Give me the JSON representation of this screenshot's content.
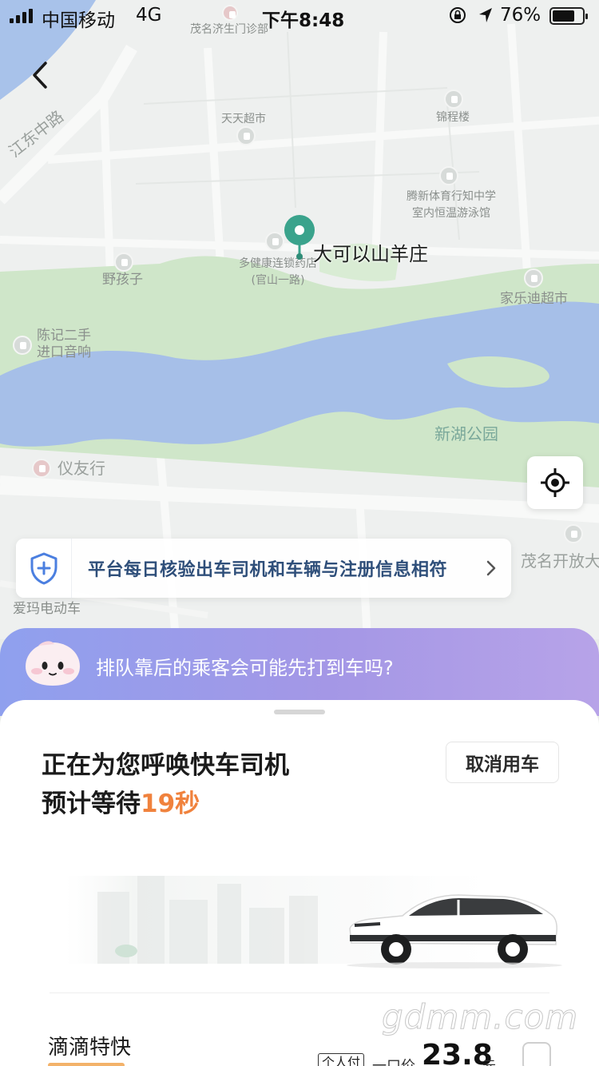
{
  "status_bar": {
    "carrier": "中国移动",
    "network": "4G",
    "time": "下午8:48",
    "battery_percent": "76%",
    "battery_level": 0.76
  },
  "map": {
    "road_label": "江东中路",
    "pin_label": "大可以山羊庄",
    "pois": [
      {
        "name": "茂名济生门诊部"
      },
      {
        "name": "天天超市"
      },
      {
        "name": "锦程楼"
      },
      {
        "name": "腾新体育行知中学\n室内恒温游泳馆"
      },
      {
        "name": "多健康连锁药店\n(官山一路)"
      },
      {
        "name": "野孩子"
      },
      {
        "name": "家乐迪超市"
      },
      {
        "name": "陈记二手\n进口音响"
      },
      {
        "name": "新湖公园"
      },
      {
        "name": "仪友行"
      },
      {
        "name": "茂名开放大"
      },
      {
        "name": "爱玛电动车"
      }
    ],
    "colors": {
      "water": "#9fb9e6",
      "park": "#c9e3c3",
      "land": "#eef0ef",
      "pin": "#3aa38c"
    }
  },
  "safety_banner": {
    "text": "平台每日核验出车司机和车辆与注册信息相符",
    "icon": "shield-plus-icon"
  },
  "queue_tip": {
    "text": "排队靠后的乘客会可能先打到车吗?"
  },
  "sheet": {
    "title": "正在为您呼唤快车司机",
    "wait_prefix": "预计等待",
    "wait_seconds": "19秒",
    "cancel_label": "取消用车",
    "service": {
      "name": "滴滴特快",
      "pay_badge": "个人付",
      "price_prefix": "一口价",
      "price": "23.8",
      "price_unit": "元",
      "selected": false
    },
    "accent_color": "#f0823d"
  },
  "watermark": "gdmm.com"
}
